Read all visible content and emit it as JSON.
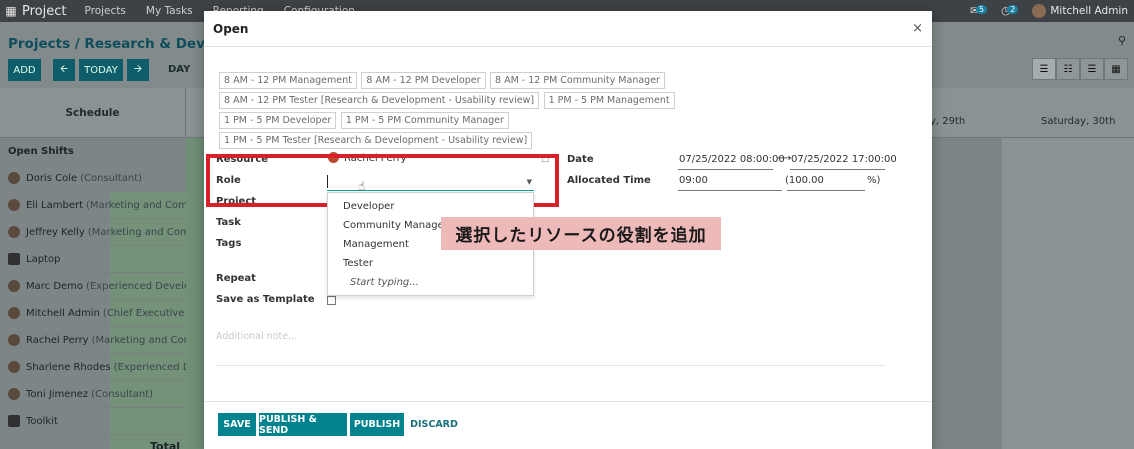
{
  "app": {
    "name": "Project",
    "menus": [
      "Projects",
      "My Tasks",
      "Reporting",
      "Configuration"
    ],
    "chat_count": "5",
    "activity_count": "2",
    "user": "Mitchell Admin"
  },
  "breadcrumb": "Projects / Research & Developme",
  "toolbar": {
    "add": "ADD",
    "today": "TODAY",
    "prev_icon": "arrow-left-icon",
    "next_icon": "arrow-right-icon",
    "day": "DAY"
  },
  "schedule": {
    "header": "Schedule",
    "day_headers": [
      "y, 29th",
      "Saturday, 30th"
    ],
    "rows": [
      {
        "name": "Open Shifts",
        "sub": ""
      },
      {
        "name": "Doris Cole",
        "sub": "(Consultant)"
      },
      {
        "name": "Eli Lambert",
        "sub": "(Marketing and Commun"
      },
      {
        "name": "Jeffrey Kelly",
        "sub": "(Marketing and Commu"
      },
      {
        "name": "Laptop",
        "sub": ""
      },
      {
        "name": "Marc Demo",
        "sub": "(Experienced Developer)"
      },
      {
        "name": "Mitchell Admin",
        "sub": "(Chief Executive Offic"
      },
      {
        "name": "Rachel Perry",
        "sub": "(Marketing and Commu"
      },
      {
        "name": "Sharlene Rhodes",
        "sub": "(Experienced Devel"
      },
      {
        "name": "Toni Jimenez",
        "sub": "(Consultant)"
      },
      {
        "name": "Toolkit",
        "sub": ""
      }
    ],
    "total": "Total"
  },
  "modal": {
    "title": "Open",
    "close_icon": "close-icon",
    "templates": [
      "8 AM - 12 PM Management",
      "8 AM - 12 PM Developer",
      "8 AM - 12 PM Community Manager",
      "8 AM - 12 PM Tester [Research & Development - Usability review]",
      "1 PM - 5 PM Management",
      "1 PM - 5 PM Developer",
      "1 PM - 5 PM Community Manager",
      "1 PM - 5 PM Tester [Research & Development - Usability review]"
    ],
    "fields": {
      "resource_label": "Resource",
      "resource_value": "Rachel Perry",
      "role_label": "Role",
      "role_value": "",
      "project_label": "Project",
      "task_label": "Task",
      "tags_label": "Tags",
      "repeat_label": "Repeat",
      "template_label": "Save as Template",
      "date_label": "Date",
      "date_start": "07/25/2022 08:00:00",
      "date_end": "07/25/2022 17:00:00",
      "allocated_label": "Allocated Time",
      "allocated_hours": "09:00",
      "allocated_percent": "(100.00",
      "percent_suffix": "%)",
      "note_placeholder": "Additional note..."
    },
    "role_options": [
      "Developer",
      "Community Manager",
      "Management",
      "Tester"
    ],
    "role_hint": "Start typing...",
    "annotation": "選択したリソースの役割を追加",
    "buttons": {
      "save": "SAVE",
      "publish_send": "PUBLISH & SEND",
      "publish": "PUBLISH",
      "discard": "DISCARD"
    }
  },
  "colors": {
    "primary": "#00838f",
    "annotation_border": "#d8202b",
    "annotation_bg": "#eeb9b9"
  }
}
